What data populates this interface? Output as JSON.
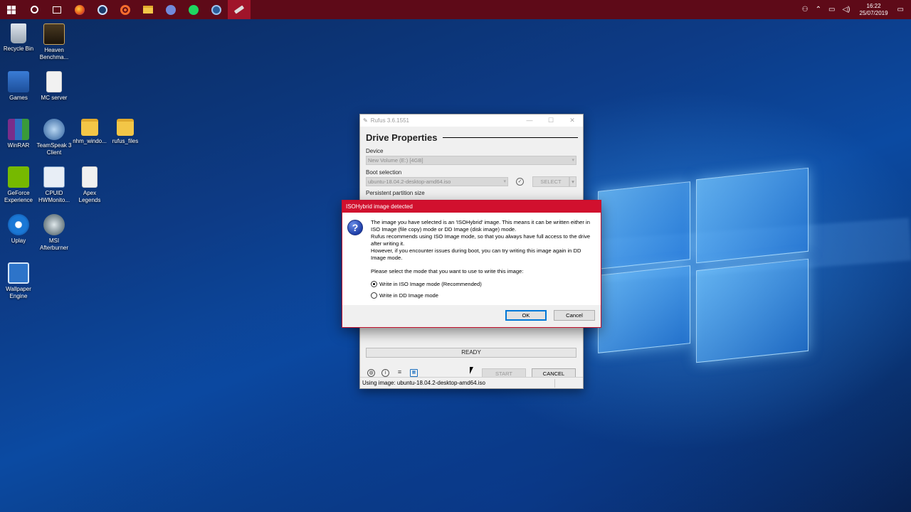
{
  "taskbar": {
    "items": [
      "windows-start-icon",
      "cortana-circle-icon",
      "task-view-icon",
      "firefox-icon",
      "steam-icon",
      "origin-icon",
      "file-explorer-icon",
      "discord-icon",
      "spotify-icon",
      "steelseries-icon",
      "rufus-icon"
    ],
    "active_index": 10,
    "clock_time": "16:22",
    "clock_date": "25/07/2019",
    "color": "#5e0a18"
  },
  "desktop": {
    "icons": [
      {
        "label": "Recycle Bin",
        "icon": "recycle-bin-icon"
      },
      {
        "label": "Heaven Benchma...",
        "icon": "heaven-benchmark-icon"
      },
      {
        "label": "Games",
        "icon": "games-icon"
      },
      {
        "label": "MC server",
        "icon": "document-icon"
      },
      {
        "label": "WinRAR",
        "icon": "winrar-icon"
      },
      {
        "label": "TeamSpeak 3 Client",
        "icon": "teamspeak-icon"
      },
      {
        "label": "nhm_windo...",
        "icon": "folder-icon"
      },
      {
        "label": "rufus_files",
        "icon": "folder-icon"
      },
      {
        "label": "GeForce Experience",
        "icon": "geforce-icon"
      },
      {
        "label": "CPUID HWMonito...",
        "icon": "cpuid-icon"
      },
      {
        "label": "Apex Legends",
        "icon": "document-icon"
      },
      {
        "label": "Uplay",
        "icon": "uplay-icon"
      },
      {
        "label": "MSI Afterburner",
        "icon": "msi-afterburner-icon"
      },
      {
        "label": "Wallpaper Engine",
        "icon": "wallpaper-engine-icon"
      }
    ]
  },
  "rufus": {
    "title": "Rufus 3.6.1551",
    "section_title": "Drive Properties",
    "device_label": "Device",
    "device_value": "New Volume (E:) [4GB]",
    "boot_label": "Boot selection",
    "boot_value": "ubuntu-18.04.2-desktop-amd64.iso",
    "select_label": "SELECT",
    "persistent_label": "Persistent partition size",
    "status": "READY",
    "start_label": "START",
    "cancel_label": "CANCEL",
    "statusbar": "Using image: ubuntu-18.04.2-desktop-amd64.iso"
  },
  "dialog": {
    "title": "ISOHybrid image detected",
    "message_1": "The image you have selected is an 'ISOHybrid' image. This means it can be written either in ISO Image (file copy) mode or DD Image (disk image) mode.",
    "message_2": "Rufus recommends using ISO Image mode, so that you always have full access to the drive after writing it.",
    "message_3": "However, if you encounter issues during boot, you can try writing this image again in DD Image mode.",
    "prompt": "Please select the mode that you want to use to write this image:",
    "option_iso": "Write in ISO Image mode (Recommended)",
    "option_dd": "Write in DD Image mode",
    "selected_option": "iso",
    "ok_label": "OK",
    "cancel_label": "Cancel",
    "accent": "#d1102e"
  }
}
